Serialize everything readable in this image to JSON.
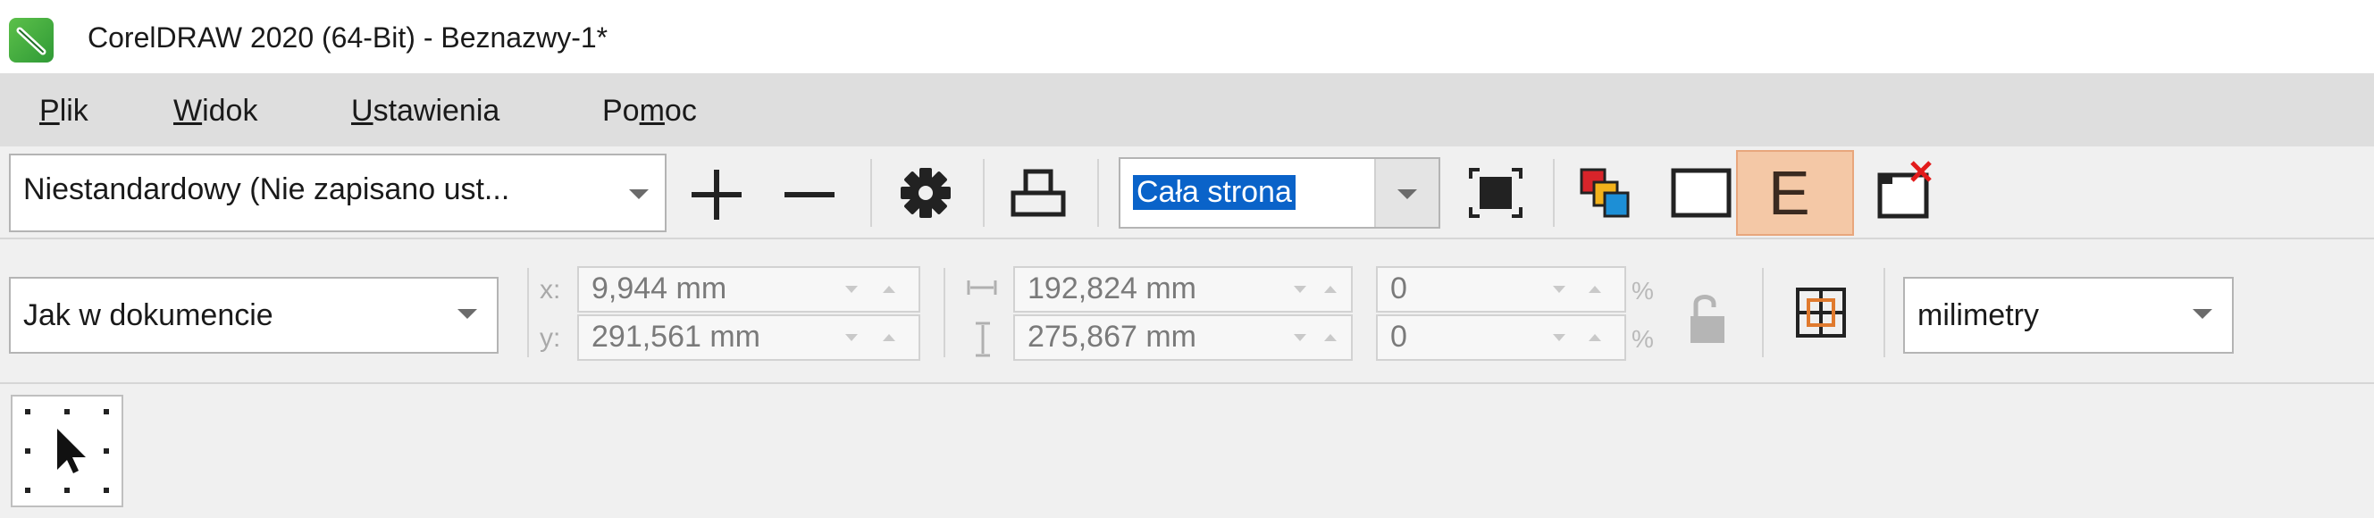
{
  "app": {
    "title": "CorelDRAW 2020 (64-Bit) - Beznazwy-1*",
    "icon": "coreldraw-app-icon",
    "accent": "#3aa53f"
  },
  "menu": {
    "file": {
      "pre": "",
      "key": "P",
      "post": "lik"
    },
    "view": {
      "pre": "",
      "key": "W",
      "post": "idok"
    },
    "settings": {
      "pre": "",
      "key": "U",
      "post": "stawienia"
    },
    "help": {
      "pre": "Po",
      "key": "m",
      "post": "oc"
    }
  },
  "toolbar1": {
    "preset": "Niestandardowy (Nie zapisano ust...",
    "add_icon": "plus-icon",
    "remove_icon": "minus-icon",
    "settings_icon": "gear-icon",
    "print_icon": "print-icon",
    "zoom": "Cała strona",
    "zoom_selection_color": "#0a63c9",
    "fit_icon": "fit-page-icon",
    "color_icon": "color-preview-icon",
    "full_screen_icon": "full-screen-preview-icon",
    "enable_icon": "enable-preview-icon",
    "enable_label": "E",
    "enable_active_color": "#f4c8a6",
    "close_icon": "close-preview-icon"
  },
  "toolbar2": {
    "page_mode": "Jak w dokumencie",
    "x_label": "x:",
    "y_label": "y:",
    "x_value": "9,944 mm",
    "y_value": "291,561 mm",
    "width_value": "192,824 mm",
    "height_value": "275,867 mm",
    "scale_x_value": "0",
    "scale_y_value": "0",
    "percent_symbol": "%",
    "lock_icon": "lock-icon",
    "tile_icon": "tile-icon",
    "units": "milimetry"
  },
  "toolbox": {
    "pick_tool_icon": "pick-tool-icon"
  }
}
